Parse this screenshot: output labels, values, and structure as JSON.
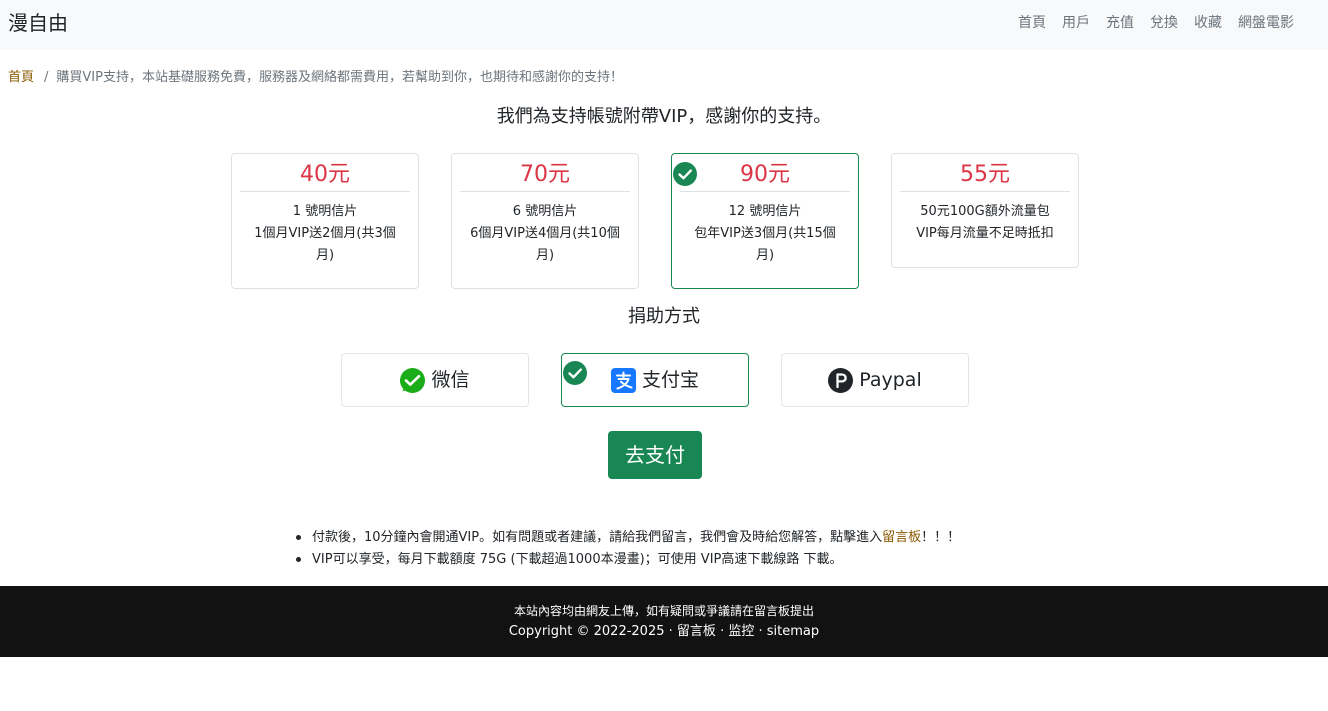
{
  "navbar": {
    "brand": "漫自由",
    "links": [
      "首頁",
      "用戶",
      "充值",
      "兌換",
      "收藏",
      "網盤電影"
    ]
  },
  "breadcrumb": {
    "home": "首頁",
    "separator": "/",
    "current": "購買VIP支持，本站基礎服務免費，服務器及網絡都需費用，若幫助到你，也期待和感謝你的支持！"
  },
  "plans_heading": "我們為支持帳號附帶VIP，感謝你的支持。",
  "plans": [
    {
      "price": "40元",
      "line1": "1 號明信片",
      "line2": "1個月VIP送2個月(共3個",
      "line3": "月)",
      "selected": false
    },
    {
      "price": "70元",
      "line1": "6 號明信片",
      "line2": "6個月VIP送4個月(共10個",
      "line3": "月)",
      "selected": false
    },
    {
      "price": "90元",
      "line1": "12 號明信片",
      "line2": "包年VIP送3個月(共15個",
      "line3": "月)",
      "selected": true
    },
    {
      "price": "55元",
      "line1": "50元100G額外流量包",
      "line2": "VIP每月流量不足時抵扣",
      "line3": "",
      "selected": false
    }
  ],
  "methods_heading": "捐助方式",
  "methods": [
    {
      "label": "微信",
      "icon": "wechat-icon",
      "color": "#1aad19",
      "selected": false
    },
    {
      "label": "支付宝",
      "icon": "alipay-icon",
      "color": "#1677ff",
      "selected": true
    },
    {
      "label": "Paypal",
      "icon": "paypal-icon",
      "color": "#212529",
      "selected": false
    }
  ],
  "pay_button": "去支付",
  "notes": {
    "item1_text": "付款後，10分鐘內會開通VIP。如有問題或者建議，請給我們留言，我們會及時給您解答，點擊進入",
    "item1_link": "留言板",
    "item1_tail": "！！！",
    "item2_text": "VIP可以享受，每月下載額度 75G (下載超過1000本漫畫)；可使用 VIP高速下載線路 下載。"
  },
  "footer": {
    "line1": "本站內容均由網友上傳，如有疑問或爭議請在留言板提出",
    "copyright": "Copyright © 2022-2025 ·",
    "link1": "留言板",
    "dot1": "·",
    "link2": "监控",
    "dot2": "·",
    "link3": "sitemap"
  },
  "colors": {
    "accent": "#198754",
    "price": "#dc3545",
    "link": "#8a5a00",
    "footer_bg": "#121212"
  }
}
